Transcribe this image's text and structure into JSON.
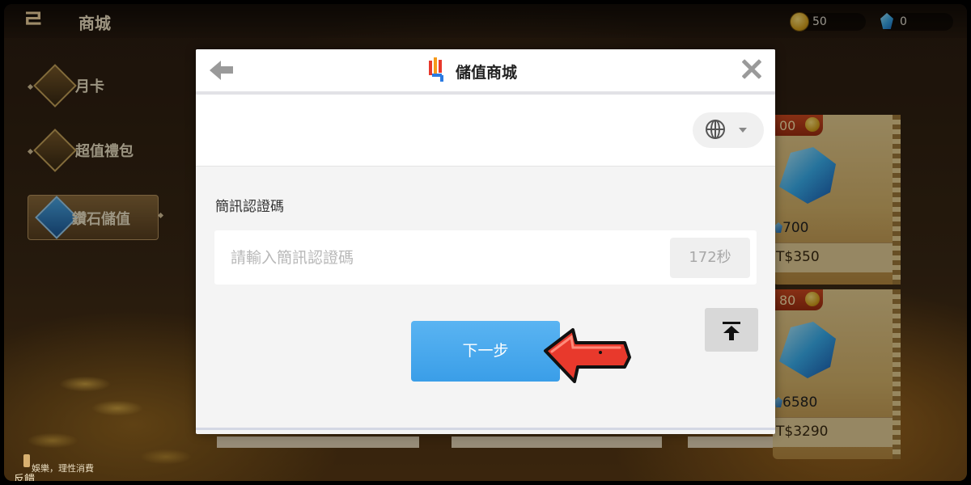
{
  "game": {
    "shop_title": "商城",
    "gold_amount": "50",
    "gem_amount": "0"
  },
  "menu": {
    "items": [
      {
        "label": "月卡"
      },
      {
        "label": "超值禮包"
      },
      {
        "label": "鑽石儲值"
      }
    ]
  },
  "cards": [
    {
      "tag_price": "00",
      "gem_amount": "700",
      "price": "T$350"
    },
    {
      "tag_price": "80",
      "gem_amount": "6580",
      "price": "T$3290"
    }
  ],
  "footer": {
    "note": "娛樂，理性消費",
    "feedback": "反饋"
  },
  "dialog": {
    "title": "儲值商城",
    "sms_label": "簡訊認證碼",
    "sms_placeholder": "請輸入簡訊認證碼",
    "countdown": "172秒",
    "next_label": "下一步"
  },
  "icons": {
    "back": "back-arrow-icon",
    "close": "close-icon",
    "language": "globe-icon",
    "scroll_top": "scroll-to-top-icon",
    "pointer": "red-pointer-arrow-icon"
  },
  "colors": {
    "primary_button": "#3a9ee8",
    "pointer_arrow": "#e8392c"
  }
}
